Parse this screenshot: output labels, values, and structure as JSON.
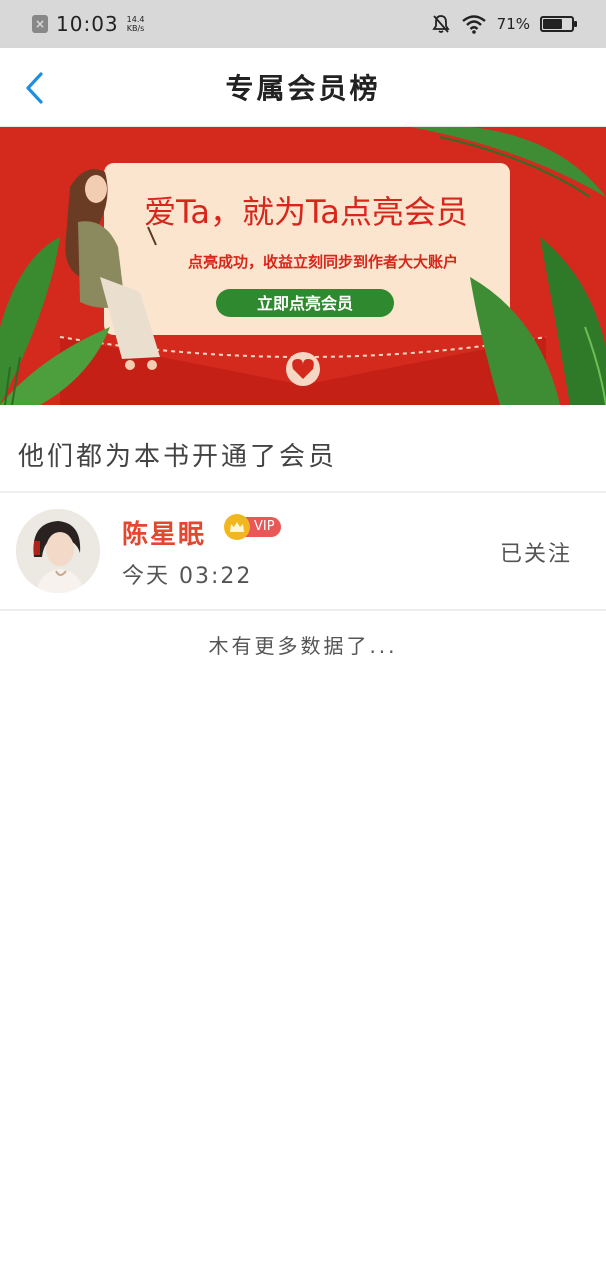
{
  "status_bar": {
    "time": "10:03",
    "speed_value": "14.4",
    "speed_unit": "KB/s",
    "battery_text": "71%",
    "battery_level": 0.71
  },
  "nav": {
    "title": "专属会员榜",
    "back_icon": "chevron-left-icon"
  },
  "banner": {
    "headline": "爱Ta，就为Ta点亮会员",
    "subline": "点亮成功，收益立刻同步到作者大大账户",
    "button_label": "立即点亮会员",
    "bg_color": "#d42a1e"
  },
  "section": {
    "title": "他们都为本书开通了会员"
  },
  "members": [
    {
      "name": "陈星眠",
      "badge": "VIP",
      "time": "今天 03:22",
      "follow_label": "已关注"
    }
  ],
  "footer": {
    "no_more": "木有更多数据了..."
  },
  "colors": {
    "accent_blue": "#1e8fe0",
    "name_red": "#e4472f",
    "vip_gold": "#f2b620",
    "vip_red": "#e95757"
  }
}
